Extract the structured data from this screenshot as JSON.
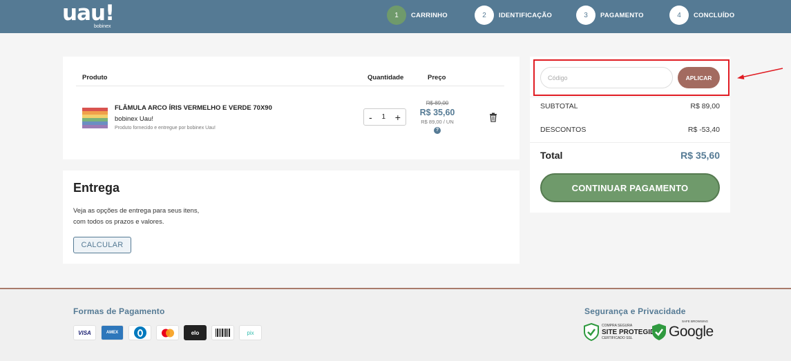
{
  "header": {
    "logo": "uau!",
    "logo_sub": "bobinex",
    "steps": [
      {
        "num": "1",
        "label": "CARRINHO",
        "active": true
      },
      {
        "num": "2",
        "label": "IDENTIFICAÇÃO",
        "active": false
      },
      {
        "num": "3",
        "label": "PAGAMENTO",
        "active": false
      },
      {
        "num": "4",
        "label": "CONCLUÍDO",
        "active": false
      }
    ]
  },
  "cart": {
    "headers": {
      "product": "Produto",
      "quantity": "Quantidade",
      "price": "Preço"
    },
    "item": {
      "name": "FLÂMULA ARCO ÍRIS VERMELHO E VERDE 70X90",
      "seller": "bobinex Uau!",
      "note": "Produto fornecido e entregue por bobinex Uau!",
      "quantity": "1",
      "minus": "-",
      "plus": "+",
      "price_old": "R$ 89,00",
      "price_now": "R$ 35,60",
      "price_unit": "R$ 89,00 / UN",
      "help": "?"
    }
  },
  "delivery": {
    "title": "Entrega",
    "line1": "Veja as opções de entrega para seus itens,",
    "line2": "com todos os prazos e valores.",
    "button": "CALCULAR"
  },
  "summary": {
    "coupon_placeholder": "Código",
    "apply": "APLICAR",
    "subtotal_label": "SUBTOTAL",
    "subtotal_value": "R$ 89,00",
    "discount_label": "DESCONTOS",
    "discount_value": "R$ -53,40",
    "total_label": "Total",
    "total_value": "R$ 35,60",
    "continue": "CONTINUAR PAGAMENTO"
  },
  "footer": {
    "payment_title": "Formas de Pagamento",
    "payment_methods": [
      "VISA",
      "AMEX",
      "Diners",
      "Mastercard",
      "elo",
      "Boleto",
      "pix"
    ],
    "security_title": "Segurança e Privacidade",
    "seal1_small": "COMPRA SEGURA",
    "seal1_big1": "SITE",
    "seal1_big2": "PROTEGIDO",
    "seal1_small2": "CERTIFICADO SSL",
    "seal2_small": "SAFE BROWSING",
    "seal2_name": "Google"
  }
}
